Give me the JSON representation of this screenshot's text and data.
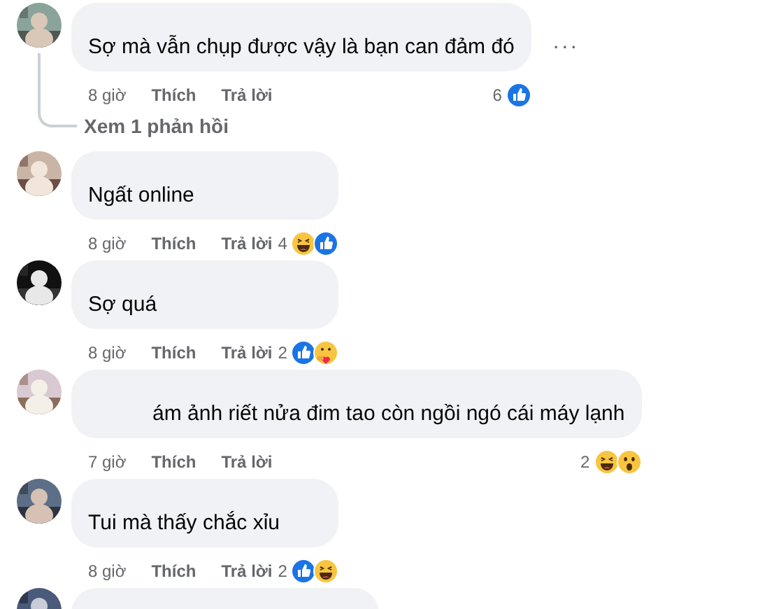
{
  "comments": [
    {
      "kind": "comment",
      "text": "Sợ mà vẫn chụp được vậy là bạn can đảm đó",
      "more": "···",
      "time": "8 giờ",
      "like": "Thích",
      "reply": "Trả lời",
      "count": "6",
      "reactions": [
        {
          "kind": "like"
        }
      ],
      "replies_link": "Xem 1 phản hồi"
    },
    {
      "kind": "comment",
      "text": "Ngất online",
      "time": "8 giờ",
      "like": "Thích",
      "reply": "Trả lời",
      "count": "4",
      "reactions": [
        {
          "kind": "haha"
        },
        {
          "kind": "like"
        }
      ]
    },
    {
      "kind": "comment",
      "text": "Sợ quá",
      "time": "8 giờ",
      "like": "Thích",
      "reply": "Trả lời",
      "count": "2",
      "reactions": [
        {
          "kind": "like"
        },
        {
          "kind": "care"
        }
      ]
    },
    {
      "kind": "comment",
      "text": "ám ảnh riết nửa đim tao còn ngồi ngó cái máy lạnh",
      "obscured_start": true,
      "time": "7 giờ",
      "like": "Thích",
      "reply": "Trả lời",
      "count": "2",
      "reactions": [
        {
          "kind": "haha"
        },
        {
          "kind": "wow"
        }
      ]
    },
    {
      "kind": "comment",
      "text": "Tui mà thấy chắc xỉu",
      "time": "8 giờ",
      "like": "Thích",
      "reply": "Trả lời",
      "count": "2",
      "reactions": [
        {
          "kind": "like"
        },
        {
          "kind": "haha"
        }
      ]
    },
    {
      "kind": "cut"
    }
  ]
}
